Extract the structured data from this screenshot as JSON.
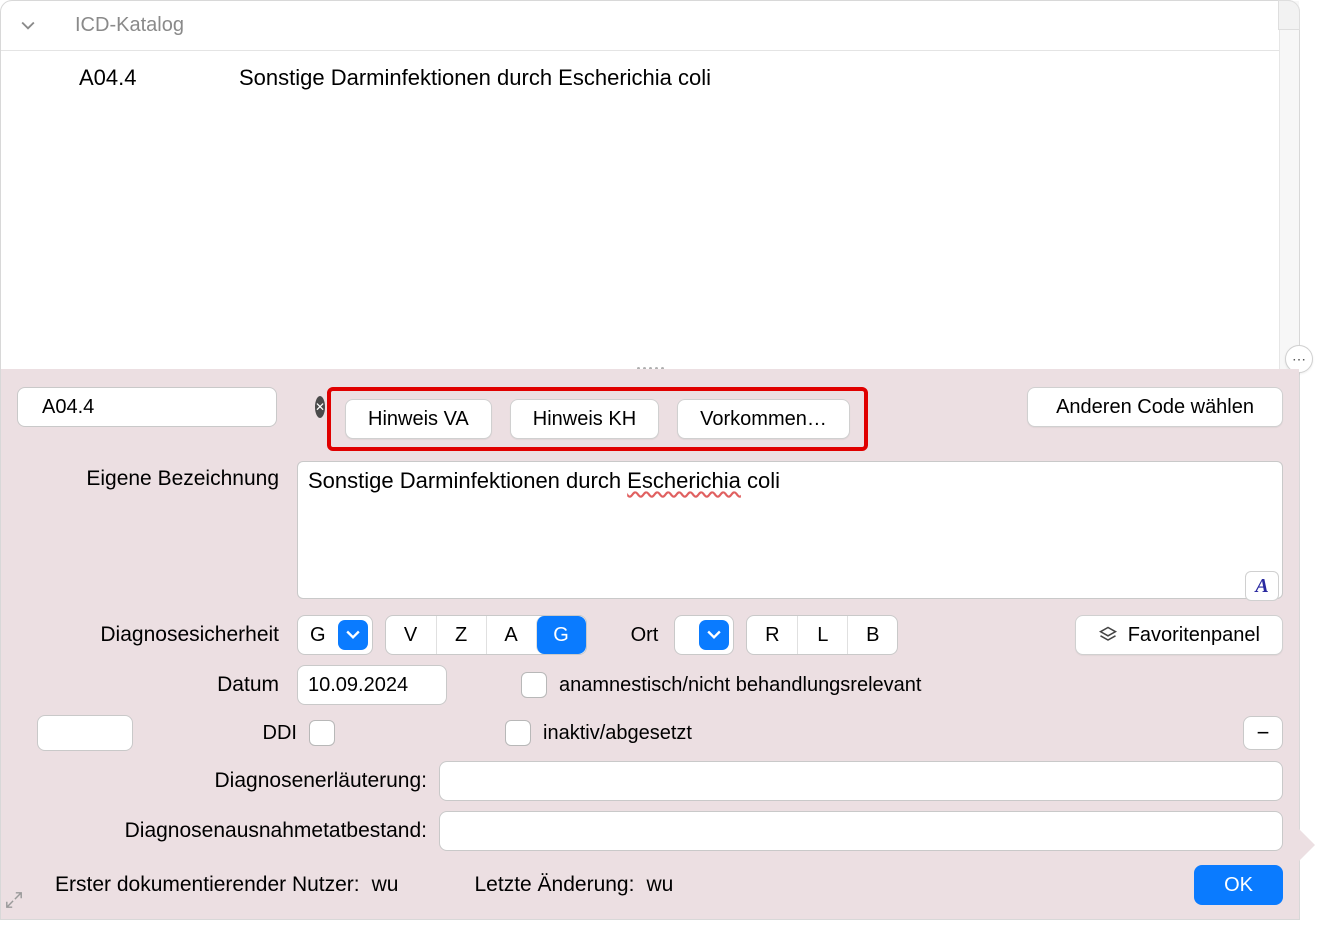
{
  "header": {
    "title": "ICD-Katalog"
  },
  "catalog": {
    "code": "A04.4",
    "description": "Sonstige Darminfektionen durch Escherichia coli"
  },
  "search": {
    "value": "A04.4"
  },
  "hint_buttons": {
    "va": "Hinweis VA",
    "kh": "Hinweis KH",
    "vorkommen": "Vorkommen…"
  },
  "other_code_btn": "Anderen Code wählen",
  "labels": {
    "eigene_bezeichnung": "Eigene Bezeichnung",
    "diagnosesicherheit": "Diagnosesicherheit",
    "ort": "Ort",
    "favoritenpanel": "Favoritenpanel",
    "datum": "Datum",
    "ddi": "DDI",
    "anamnestisch": "anamnestisch/nicht behandlungsrelevant",
    "inaktiv": "inaktiv/abgesetzt",
    "erlaeuterung": "Diagnosenerläuterung:",
    "ausnahmetatbestand": "Diagnosenausnahmetatbestand:"
  },
  "own_desc": {
    "prefix": "Sonstige Darminfektionen durch ",
    "spell_word": "Escherichia",
    "suffix": " coli"
  },
  "diag_security": {
    "selected": "G",
    "options": [
      "V",
      "Z",
      "A",
      "G"
    ]
  },
  "ort": {
    "selected": "",
    "options": [
      "R",
      "L",
      "B"
    ]
  },
  "datum_value": "10.09.2024",
  "footer": {
    "first_user_label": "Erster dokumentierender Nutzer:",
    "first_user_value": "wu",
    "last_change_label": "Letzte Änderung:",
    "last_change_value": "wu",
    "ok": "OK"
  }
}
